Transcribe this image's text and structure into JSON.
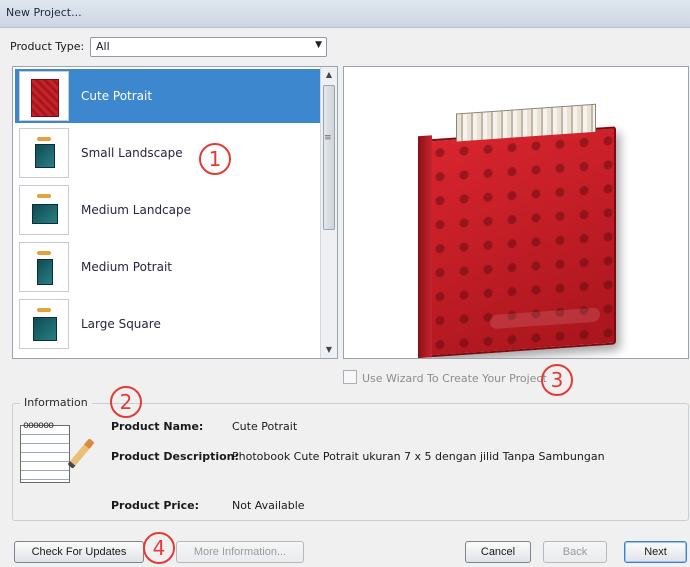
{
  "window": {
    "title": "New Project..."
  },
  "product_type": {
    "label": "Product Type:",
    "selected": "All"
  },
  "products": [
    {
      "name": "Cute Potrait",
      "selected": true
    },
    {
      "name": "Small Landscape",
      "selected": false
    },
    {
      "name": "Medium Landcape",
      "selected": false
    },
    {
      "name": "Medium Potrait",
      "selected": false
    },
    {
      "name": "Large Square",
      "selected": false
    }
  ],
  "wizard": {
    "label": "Use Wizard To Create Your Project",
    "checked": false
  },
  "information": {
    "title": "Information",
    "product_name_label": "Product Name:",
    "product_name": "Cute Potrait",
    "product_description_label": "Product Description:",
    "product_description": "Photobook Cute Potrait ukuran 7 x 5  dengan jilid Tanpa Sambungan",
    "product_price_label": "Product Price:",
    "product_price": "Not Available"
  },
  "annotations": [
    "1",
    "2",
    "3",
    "4"
  ],
  "buttons": {
    "check_updates": "Check For Updates",
    "more_info": "More Information...",
    "cancel": "Cancel",
    "back": "Back",
    "next": "Next"
  },
  "colors": {
    "selection": "#3d87cf",
    "annotation": "#e23b35",
    "book_red": "#c4232b"
  }
}
